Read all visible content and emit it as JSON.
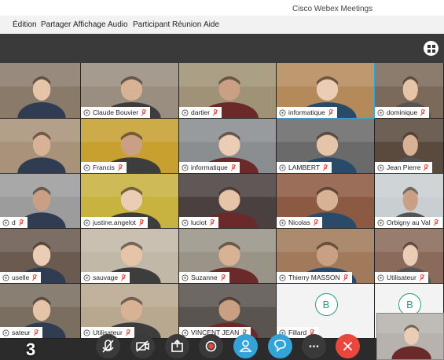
{
  "window": {
    "title": "Cisco Webex Meetings"
  },
  "menu": [
    "Édition",
    "Partager",
    "Affichage",
    "Audio",
    "Participant",
    "Réunion",
    "Aide"
  ],
  "participants": [
    {
      "name": "",
      "bg": "#8a7a6a",
      "active": false,
      "video": true
    },
    {
      "name": "Claude Bouvier",
      "bg": "#9a8e80",
      "active": false,
      "video": true
    },
    {
      "name": "dartier",
      "bg": "#a09276",
      "active": false,
      "video": true
    },
    {
      "name": "informatique",
      "bg": "#b58a5a",
      "active": true,
      "video": true
    },
    {
      "name": "dominique",
      "bg": "#7b6a5a",
      "active": false,
      "video": true
    },
    {
      "name": "",
      "bg": "#a8937a",
      "active": false,
      "video": true
    },
    {
      "name": "Francis",
      "bg": "#c8a030",
      "active": false,
      "video": true
    },
    {
      "name": "informatique",
      "bg": "#8a8e90",
      "active": false,
      "video": true
    },
    {
      "name": "LAMBERT",
      "bg": "#6a6a6a",
      "active": false,
      "video": true
    },
    {
      "name": "Jean Pierre",
      "bg": "#5a4a3e",
      "active": false,
      "video": true
    },
    {
      "name": "d",
      "bg": "#9c9c9c",
      "active": false,
      "video": true
    },
    {
      "name": "justine.angelot",
      "bg": "#c8b240",
      "active": false,
      "video": true
    },
    {
      "name": "luciot",
      "bg": "#4a4040",
      "active": false,
      "video": true
    },
    {
      "name": "Nicolas",
      "bg": "#8c5a42",
      "active": false,
      "video": true
    },
    {
      "name": "Orbigny au Val",
      "bg": "#c9ced2",
      "active": false,
      "video": true
    },
    {
      "name": "uselle",
      "bg": "#6a5a50",
      "active": false,
      "video": true
    },
    {
      "name": "sauvage",
      "bg": "#c2b8a8",
      "active": false,
      "video": true
    },
    {
      "name": "Suzanne",
      "bg": "#9a9488",
      "active": false,
      "video": true
    },
    {
      "name": "Thierry MASSON",
      "bg": "#a07a5a",
      "active": false,
      "video": true
    },
    {
      "name": "Utilisateur",
      "bg": "#8a6a5a",
      "active": false,
      "video": true
    },
    {
      "name": "sateur",
      "bg": "#7a6e60",
      "active": false,
      "video": true
    },
    {
      "name": "Utilisateur",
      "bg": "#b8a890",
      "active": false,
      "video": true
    },
    {
      "name": "VINCENT JEAN",
      "bg": "#5a5450",
      "active": false,
      "video": true
    },
    {
      "name": "Fillard",
      "bg": "#f3f3f3",
      "active": false,
      "video": false,
      "initial": "B"
    },
    {
      "name": "",
      "bg": "#f3f3f3",
      "active": false,
      "video": false,
      "initial": "B"
    }
  ],
  "controls": [
    "mute-mic",
    "stop-video",
    "share",
    "record",
    "participants",
    "chat",
    "more",
    "leave"
  ],
  "colors": {
    "accent": "#34a3d8",
    "leave": "#e8473e",
    "dark": "#3a3a3a",
    "mute": "#e0443a"
  },
  "badge": "3"
}
